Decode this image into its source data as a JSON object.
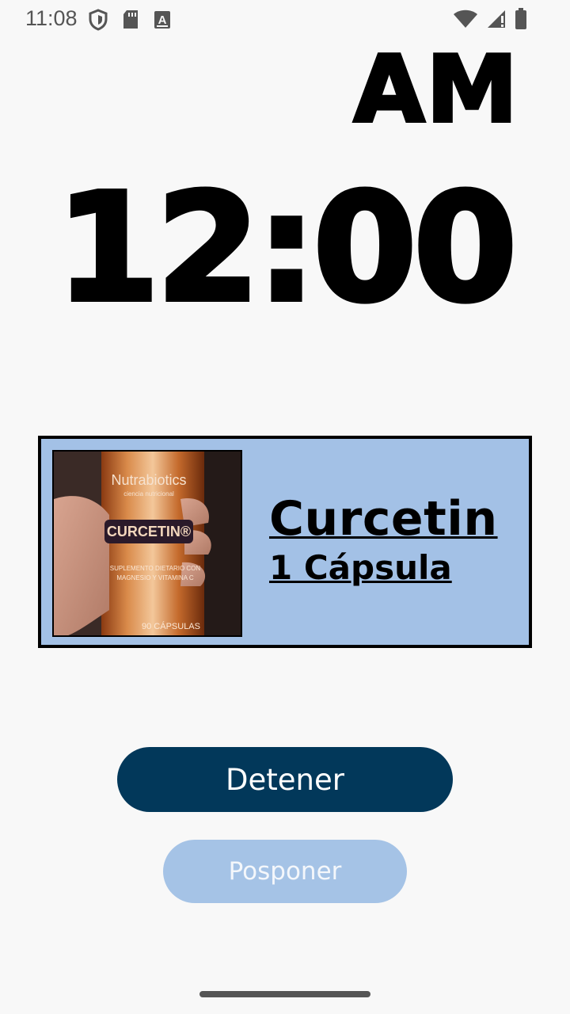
{
  "status_bar": {
    "time": "11:08",
    "left_icons": [
      "shield-icon",
      "sd-card-icon",
      "text-a-icon"
    ],
    "right_icons": [
      "wifi-icon",
      "signal-icon",
      "battery-icon"
    ]
  },
  "alarm": {
    "period": "AM",
    "time": "12:00"
  },
  "medication": {
    "name": "Curcetin",
    "dose": "1 Cápsula",
    "photo": {
      "brand": "Nutrabiotics",
      "tagline": "ciencia nutricional",
      "product": "CURCETIN®",
      "description_line1": "SUPLEMENTO DIETARIO CON",
      "description_line2": "MAGNESIO Y VITAMINA C",
      "count": "90 CÁPSULAS"
    }
  },
  "actions": {
    "stop_label": "Detener",
    "snooze_label": "Posponer"
  },
  "colors": {
    "card_background": "#a3c1e6",
    "stop_button": "#02385a",
    "snooze_button": "#a5c3e6",
    "page_background": "#f8f8f8"
  }
}
